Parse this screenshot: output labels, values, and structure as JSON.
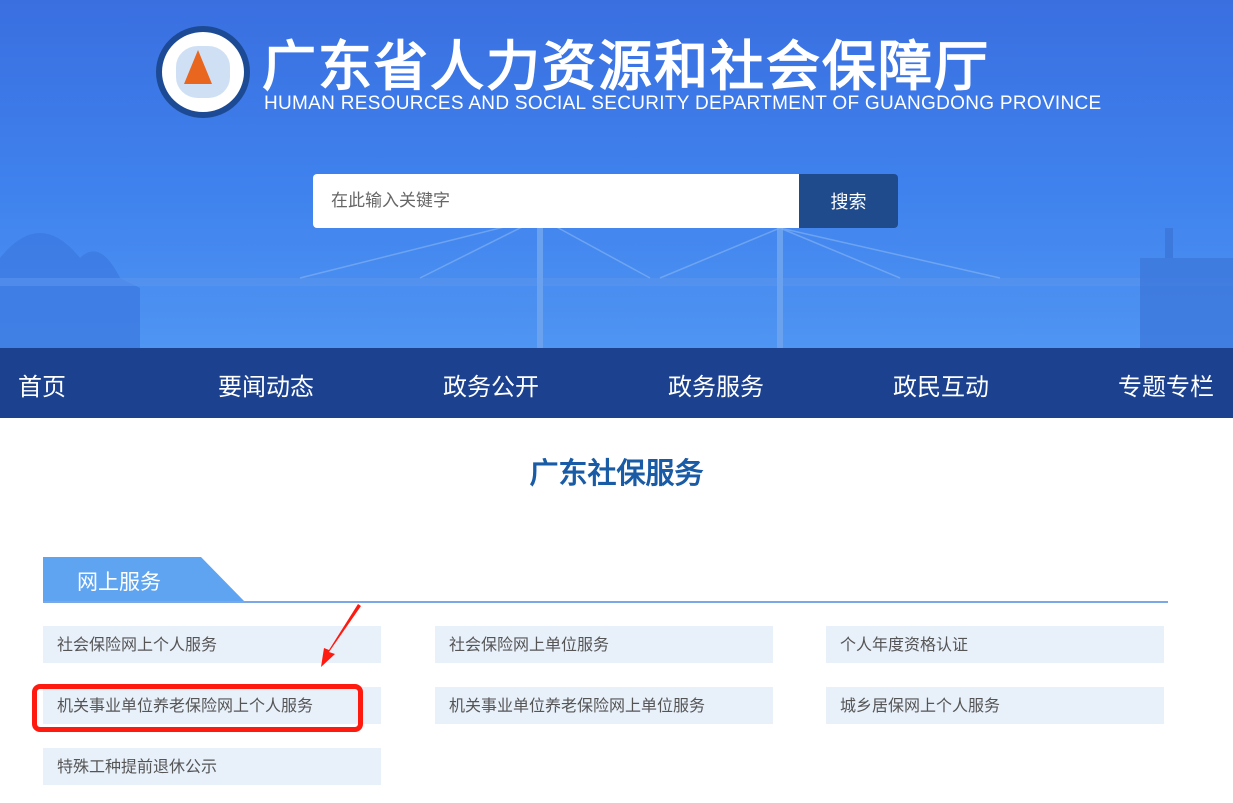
{
  "header": {
    "title_cn": "广东省人力资源和社会保障厅",
    "title_en": "HUMAN RESOURCES AND SOCIAL SECURITY DEPARTMENT OF GUANGDONG PROVINCE",
    "logo_text": "广东省人力资源和社会保障厅"
  },
  "search": {
    "placeholder": "在此输入关键字",
    "button": "搜索"
  },
  "nav": [
    "首页",
    "要闻动态",
    "政务公开",
    "政务服务",
    "政民互动",
    "专题专栏"
  ],
  "page_title": "广东社保服务",
  "section_tab": "网上服务",
  "services": [
    "社会保险网上个人服务",
    "社会保险网上单位服务",
    "个人年度资格认证",
    "机关事业单位养老保险网上个人服务",
    "机关事业单位养老保险网上单位服务",
    "城乡居保网上个人服务",
    "特殊工种提前退休公示"
  ],
  "colors": {
    "nav": "#1c428f",
    "accent": "#1a5ba6",
    "tab": "#5fa4f0",
    "highlight": "#ff1a0f"
  }
}
